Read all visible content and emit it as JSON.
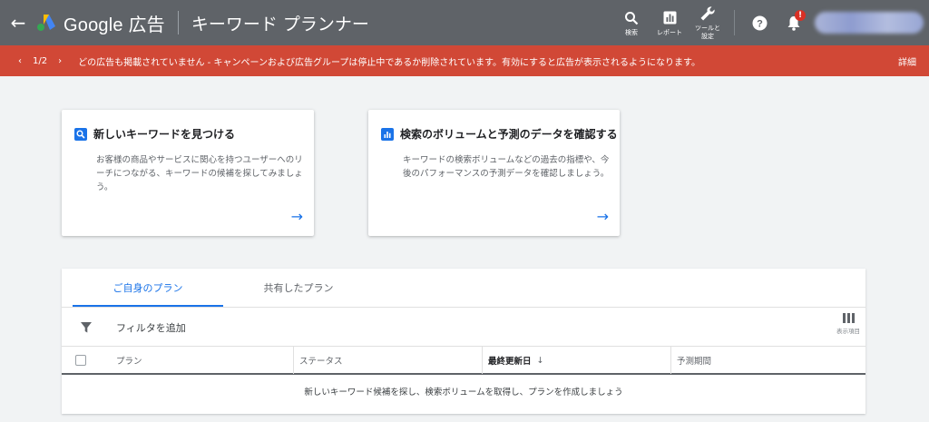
{
  "header": {
    "brand": "Google 広告",
    "page_title": "キーワード プランナー",
    "actions": [
      {
        "label": "検索",
        "icon": "search-icon"
      },
      {
        "label": "レポート",
        "icon": "report-icon"
      },
      {
        "label": "ツールと設定",
        "icon": "wrench-icon"
      }
    ],
    "help_icon": "help-icon",
    "notification_badge": "!"
  },
  "alert": {
    "pager": "1/2",
    "message": "どの広告も掲載されていません - キャンペーンおよび広告グループは停止中であるか削除されています。有効にすると広告が表示されるようになります。",
    "detail_label": "詳細",
    "color": "#d14836"
  },
  "cards": [
    {
      "title": "新しいキーワードを見つける",
      "description": "お客様の商品やサービスに関心を持つユーザーへのリーチにつながる、キーワードの候補を探してみましょう。",
      "icon": "search-icon"
    },
    {
      "title": "検索のボリュームと予測のデータを確認する",
      "description": "キーワードの検索ボリュームなどの過去の指標や、今後のパフォーマンスの予測データを確認しましょう。",
      "icon": "chart-icon"
    }
  ],
  "plans": {
    "tabs": [
      "ご自身のプラン",
      "共有したプラン"
    ],
    "active_tab": 0,
    "filter_label": "フィルタを追加",
    "columns_button_label": "表示項目",
    "columns": {
      "plan": "プラン",
      "status": "ステータス",
      "updated": "最終更新日",
      "period": "予測期間"
    },
    "sort_indicator": "↓",
    "empty_message": "新しいキーワード候補を探し、検索ボリュームを取得し、プランを作成しましょう"
  },
  "colors": {
    "header_bg": "#5f6368",
    "accent": "#1a73e8",
    "alert": "#d14836"
  }
}
